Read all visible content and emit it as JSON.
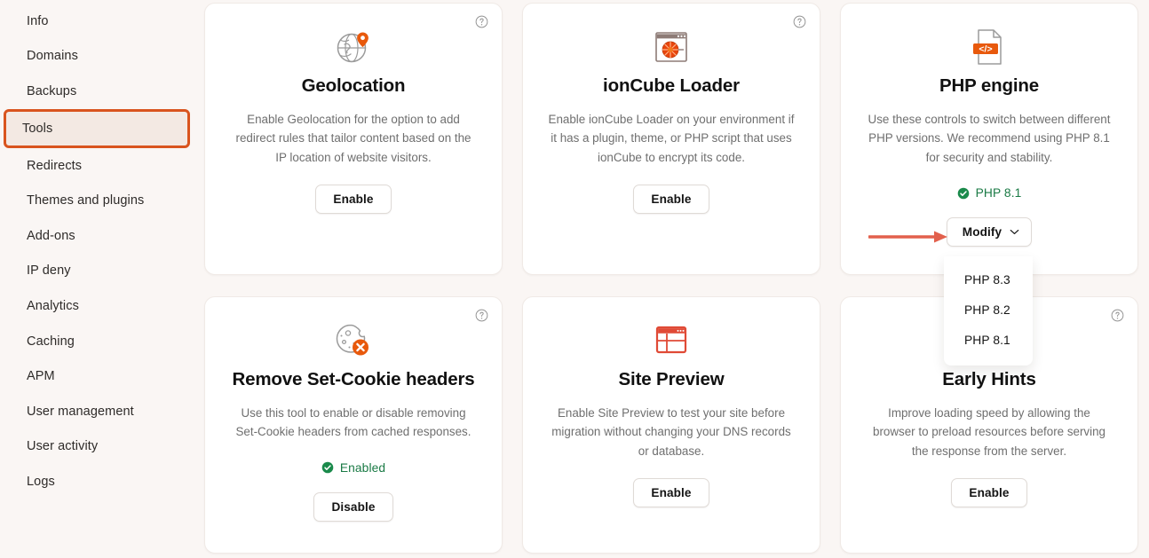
{
  "sidebar": {
    "items": [
      {
        "label": "Info",
        "name": "sidebar-item-info",
        "selected": false
      },
      {
        "label": "Domains",
        "name": "sidebar-item-domains",
        "selected": false
      },
      {
        "label": "Backups",
        "name": "sidebar-item-backups",
        "selected": false
      },
      {
        "label": "Tools",
        "name": "sidebar-item-tools",
        "selected": true
      },
      {
        "label": "Redirects",
        "name": "sidebar-item-redirects",
        "selected": false
      },
      {
        "label": "Themes and plugins",
        "name": "sidebar-item-themes-plugins",
        "selected": false
      },
      {
        "label": "Add-ons",
        "name": "sidebar-item-add-ons",
        "selected": false
      },
      {
        "label": "IP deny",
        "name": "sidebar-item-ip-deny",
        "selected": false
      },
      {
        "label": "Analytics",
        "name": "sidebar-item-analytics",
        "selected": false
      },
      {
        "label": "Caching",
        "name": "sidebar-item-caching",
        "selected": false
      },
      {
        "label": "APM",
        "name": "sidebar-item-apm",
        "selected": false
      },
      {
        "label": "User management",
        "name": "sidebar-item-user-management",
        "selected": false
      },
      {
        "label": "User activity",
        "name": "sidebar-item-user-activity",
        "selected": false
      },
      {
        "label": "Logs",
        "name": "sidebar-item-logs",
        "selected": false
      }
    ]
  },
  "cards": {
    "geolocation": {
      "title": "Geolocation",
      "description": "Enable Geolocation for the option to add redirect rules that tailor content based on the IP location of website visitors.",
      "button_label": "Enable",
      "icon": "globe-pin-icon"
    },
    "ioncube": {
      "title": "ionCube Loader",
      "description": "Enable ionCube Loader on your environment if it has a plugin, theme, or PHP script that uses ionCube to encrypt its code.",
      "button_label": "Enable",
      "icon": "ioncube-window-icon"
    },
    "php_engine": {
      "title": "PHP engine",
      "description": "Use these controls to switch between different PHP versions. We recommend using PHP 8.1 for security and stability.",
      "status_label": "PHP 8.1",
      "button_label": "Modify",
      "icon": "php-file-code-icon",
      "dropdown_options": [
        "PHP 8.3",
        "PHP 8.2",
        "PHP 8.1"
      ]
    },
    "set_cookie": {
      "title": "Remove Set-Cookie headers",
      "description": "Use this tool to enable or disable removing Set-Cookie headers from cached responses.",
      "status_label": "Enabled",
      "button_label": "Disable",
      "icon": "cookie-x-icon"
    },
    "site_preview": {
      "title": "Site Preview",
      "description": "Enable Site Preview to test your site before migration without changing your DNS records or database.",
      "button_label": "Enable",
      "icon": "browser-window-icon"
    },
    "early_hints": {
      "title": "Early Hints",
      "description": "Improve loading speed by allowing the browser to preload resources before serving the response from the server.",
      "button_label": "Enable",
      "icon": "none"
    }
  },
  "annotations": {
    "arrow": {
      "name": "red-arrow-annotation",
      "color": "#e2604c",
      "points_to": "Modify"
    },
    "highlight_box": {
      "name": "orange-highlight-box",
      "color": "#d9541e",
      "around": "Tools"
    }
  },
  "colors": {
    "page_background": "#faf6f4",
    "card_background": "#ffffff",
    "accent_orange": "#e8590c",
    "status_green": "#1a7a45",
    "annotation_red": "#e2604c",
    "annotation_orange": "#d9541e",
    "text_primary": "#111111",
    "text_muted": "#6f6f6f"
  },
  "icon_names": {
    "help": "help-circle-icon",
    "chevron": "chevron-down-icon",
    "check": "check-circle-icon"
  }
}
